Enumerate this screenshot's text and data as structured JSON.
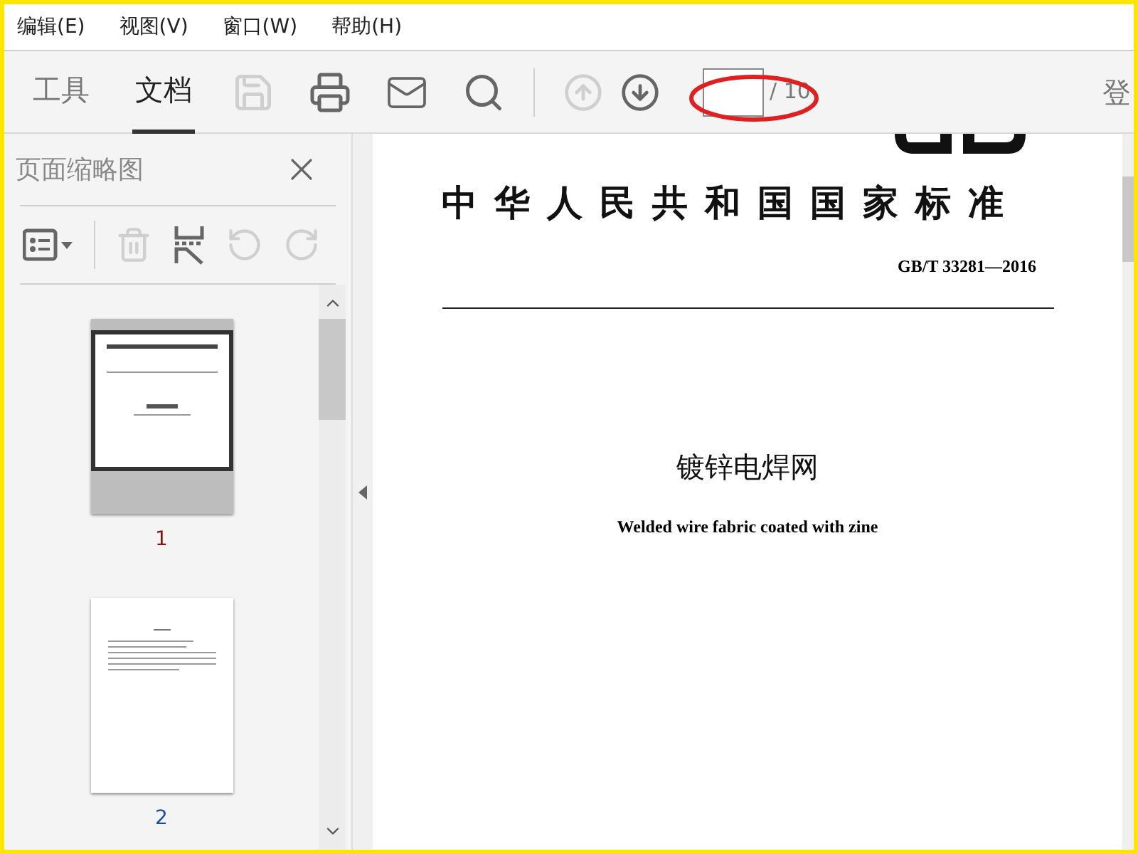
{
  "menu": [
    "编辑(E)",
    "视图(V)",
    "窗口(W)",
    "帮助(H)"
  ],
  "tabs": [
    {
      "label": "工具",
      "selected": false
    },
    {
      "label": "文档",
      "selected": true
    }
  ],
  "tools": [
    {
      "kind": "save",
      "disabled": true
    },
    {
      "kind": "print",
      "disabled": false
    },
    {
      "kind": "mail",
      "disabled": false
    },
    {
      "kind": "search",
      "disabled": false
    },
    {
      "kind": "up",
      "disabled": true
    },
    {
      "kind": "down",
      "disabled": false
    }
  ],
  "page_nav": {
    "total": "/ 10"
  },
  "sign_in": "登",
  "sidebar": {
    "title": "页面缩略图",
    "tools": [
      {
        "kind": "options",
        "disabled": false
      },
      {
        "kind": "delete",
        "disabled": true
      },
      {
        "kind": "extract",
        "disabled": false
      },
      {
        "kind": "undo",
        "disabled": true
      },
      {
        "kind": "redo",
        "disabled": true
      }
    ],
    "thumbnails": [
      {
        "label": "1",
        "selected": true
      },
      {
        "label": "2",
        "selected": false
      }
    ]
  },
  "document": {
    "title": "中华人民共和国国家标准",
    "code": "GB/T 33281—2016",
    "name_cn": "镀锌电焊网",
    "name_en": "Welded wire fabric coated with zine"
  }
}
